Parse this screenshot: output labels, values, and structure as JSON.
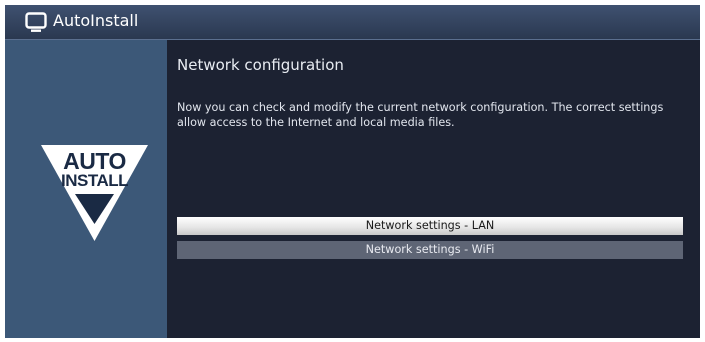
{
  "window": {
    "title": "AutoInstall",
    "icon": "tv-icon"
  },
  "sidebar": {
    "logo": {
      "line1": "AUTO",
      "line2": "INSTALL",
      "icon": "autoinstall-triangle-logo"
    }
  },
  "main": {
    "title": "Network configuration",
    "description": "Now you can check and modify the current network configuration. The correct settings allow access to the Internet and local media files.",
    "menu": [
      {
        "label": "Network settings - LAN",
        "selected": true
      },
      {
        "label": "Network settings - WiFi",
        "selected": false
      }
    ]
  },
  "colors": {
    "header": "#34445f",
    "sidebar": "#3c5878",
    "background": "#1c2232",
    "selected_item": "#f0f0f0",
    "normal_item": "#5e6575"
  }
}
